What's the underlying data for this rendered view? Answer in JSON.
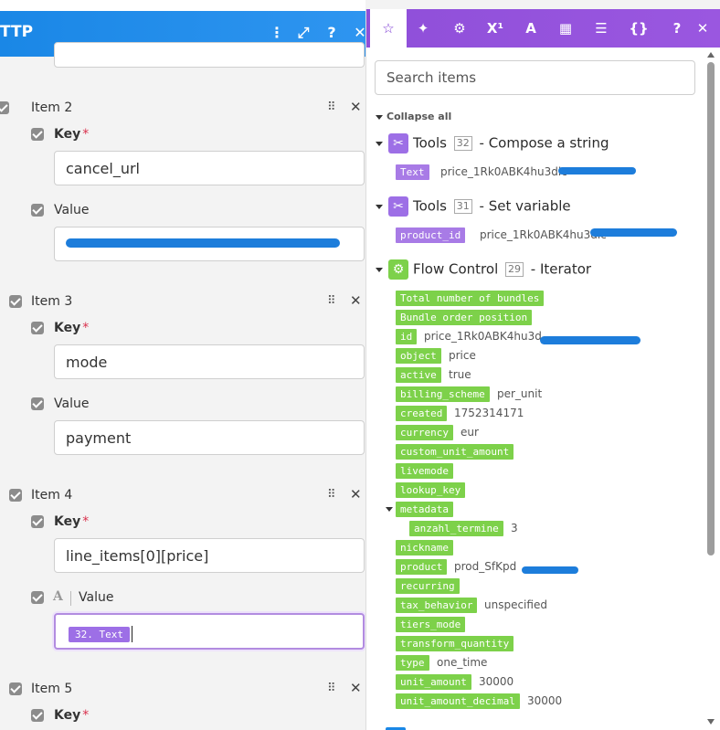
{
  "left": {
    "header_title": "TTP",
    "items": [
      {
        "label": "Item 2",
        "key_label": "Key",
        "key_value": "cancel_url",
        "value_label": "Value",
        "value_value": ""
      },
      {
        "label": "Item 3",
        "key_label": "Key",
        "key_value": "mode",
        "value_label": "Value",
        "value_value": "payment"
      },
      {
        "label": "Item 4",
        "key_label": "Key",
        "key_value": "line_items[0][price]",
        "value_label": "Value",
        "value_pill": "32. Text"
      },
      {
        "label": "Item 5",
        "key_label": "Key"
      }
    ],
    "required_mark": "*"
  },
  "right": {
    "search_placeholder": "Search items",
    "collapse_label": "Collapse all",
    "modules": [
      {
        "app": "Tools",
        "num": "32",
        "desc": "- Compose a string",
        "color": "#9d6fe6"
      },
      {
        "app": "Tools",
        "num": "31",
        "desc": "- Set variable",
        "color": "#9d6fe6"
      },
      {
        "app": "Flow Control",
        "num": "29",
        "desc": "- Iterator",
        "color": "#7dd14a"
      }
    ],
    "text_item": {
      "key": "Text",
      "value": "price_1Rk0ABK4hu3dlc"
    },
    "product_id_item": {
      "key": "product_id",
      "value": "price_1Rk0ABK4hu3dlc"
    },
    "iterator_fields": [
      {
        "key": "Total number of bundles",
        "value": ""
      },
      {
        "key": "Bundle order position",
        "value": ""
      },
      {
        "key": "id",
        "value": "price_1Rk0ABK4hu3d"
      },
      {
        "key": "object",
        "value": "price"
      },
      {
        "key": "active",
        "value": "true"
      },
      {
        "key": "billing_scheme",
        "value": "per_unit"
      },
      {
        "key": "created",
        "value": "1752314171"
      },
      {
        "key": "currency",
        "value": "eur"
      },
      {
        "key": "custom_unit_amount",
        "value": ""
      },
      {
        "key": "livemode",
        "value": ""
      },
      {
        "key": "lookup_key",
        "value": ""
      },
      {
        "key": "metadata",
        "value": ""
      },
      {
        "key": "anzahl_termine",
        "value": "3"
      },
      {
        "key": "nickname",
        "value": ""
      },
      {
        "key": "product",
        "value": "prod_SfKpd"
      },
      {
        "key": "recurring",
        "value": ""
      },
      {
        "key": "tax_behavior",
        "value": "unspecified"
      },
      {
        "key": "tiers_mode",
        "value": ""
      },
      {
        "key": "transform_quantity",
        "value": ""
      },
      {
        "key": "type",
        "value": "one_time"
      },
      {
        "key": "unit_amount",
        "value": "30000"
      },
      {
        "key": "unit_amount_decimal",
        "value": "30000"
      }
    ],
    "tabs": [
      "star-icon",
      "sparkle-icon",
      "gear-icon",
      "superscript-icon",
      "text-icon",
      "calendar-icon",
      "table-icon",
      "braces-icon",
      "help-icon",
      "close-icon"
    ]
  }
}
